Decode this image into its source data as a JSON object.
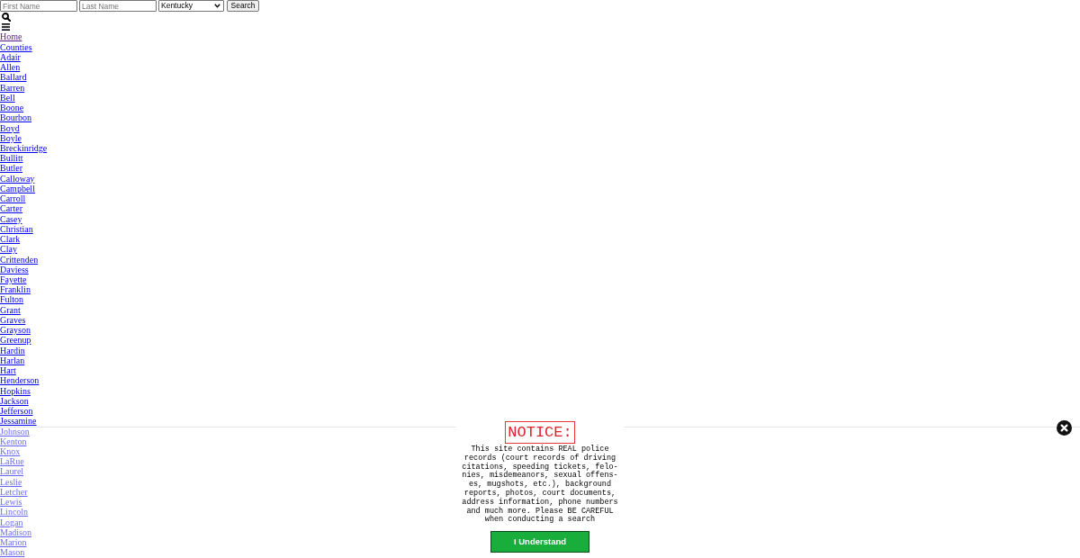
{
  "search_form": {
    "first_name": {
      "placeholder": "First Name"
    },
    "last_name": {
      "placeholder": "Last Name"
    },
    "state": {
      "value": "Kentucky"
    },
    "button": "Search"
  },
  "nav_links": [
    {
      "label": "Home",
      "visited": true
    },
    {
      "label": "Counties",
      "visited": false
    },
    {
      "label": "Adair",
      "visited": false
    },
    {
      "label": "Allen",
      "visited": false
    },
    {
      "label": "Ballard",
      "visited": false
    },
    {
      "label": "Barren",
      "visited": false
    },
    {
      "label": "Bell",
      "visited": false
    },
    {
      "label": "Boone",
      "visited": false
    },
    {
      "label": "Bourbon",
      "visited": false
    },
    {
      "label": "Boyd",
      "visited": false
    },
    {
      "label": "Boyle",
      "visited": false
    },
    {
      "label": "Breckinridge",
      "visited": false
    },
    {
      "label": "Bullitt",
      "visited": false
    },
    {
      "label": "Butler",
      "visited": false
    },
    {
      "label": "Calloway",
      "visited": false
    },
    {
      "label": "Campbell",
      "visited": false
    },
    {
      "label": "Carroll",
      "visited": false
    },
    {
      "label": "Carter",
      "visited": false
    },
    {
      "label": "Casey",
      "visited": false
    },
    {
      "label": "Christian",
      "visited": false
    },
    {
      "label": "Clark",
      "visited": false
    },
    {
      "label": "Clay",
      "visited": false
    },
    {
      "label": "Crittenden",
      "visited": false
    },
    {
      "label": "Daviess",
      "visited": false
    },
    {
      "label": "Fayette",
      "visited": false
    },
    {
      "label": "Franklin",
      "visited": false
    },
    {
      "label": "Fulton",
      "visited": false
    },
    {
      "label": "Grant",
      "visited": false
    },
    {
      "label": "Graves",
      "visited": false
    },
    {
      "label": "Grayson",
      "visited": false
    },
    {
      "label": "Greenup",
      "visited": false
    },
    {
      "label": "Hardin",
      "visited": false
    },
    {
      "label": "Harlan",
      "visited": false
    },
    {
      "label": "Hart",
      "visited": false
    },
    {
      "label": "Henderson",
      "visited": false
    },
    {
      "label": "Hopkins",
      "visited": false
    },
    {
      "label": "Jackson",
      "visited": false
    },
    {
      "label": "Jefferson",
      "visited": false
    },
    {
      "label": "Jessamine",
      "visited": false
    },
    {
      "label": "Johnson",
      "visited": false
    },
    {
      "label": "Kenton",
      "visited": false
    },
    {
      "label": "Knox",
      "visited": false
    },
    {
      "label": "LaRue",
      "visited": false
    },
    {
      "label": "Laurel",
      "visited": false
    },
    {
      "label": "Leslie",
      "visited": false
    },
    {
      "label": "Letcher",
      "visited": false
    },
    {
      "label": "Lewis",
      "visited": false
    },
    {
      "label": "Lincoln",
      "visited": false
    },
    {
      "label": "Logan",
      "visited": false
    },
    {
      "label": "Madison",
      "visited": false
    },
    {
      "label": "Marion",
      "visited": false
    },
    {
      "label": "Mason",
      "visited": false
    }
  ],
  "notice": {
    "title": "NOTICE:",
    "message": "This site contains REAL police records (court records of driving citations, speeding tickets, felo-nies, misdemeanors, sexual offens-es, mugshots, etc.), background reports, photos, court documents, address information, phone numbers and much more. Please BE CAREFUL when conducting a search",
    "button": "I Understand"
  }
}
